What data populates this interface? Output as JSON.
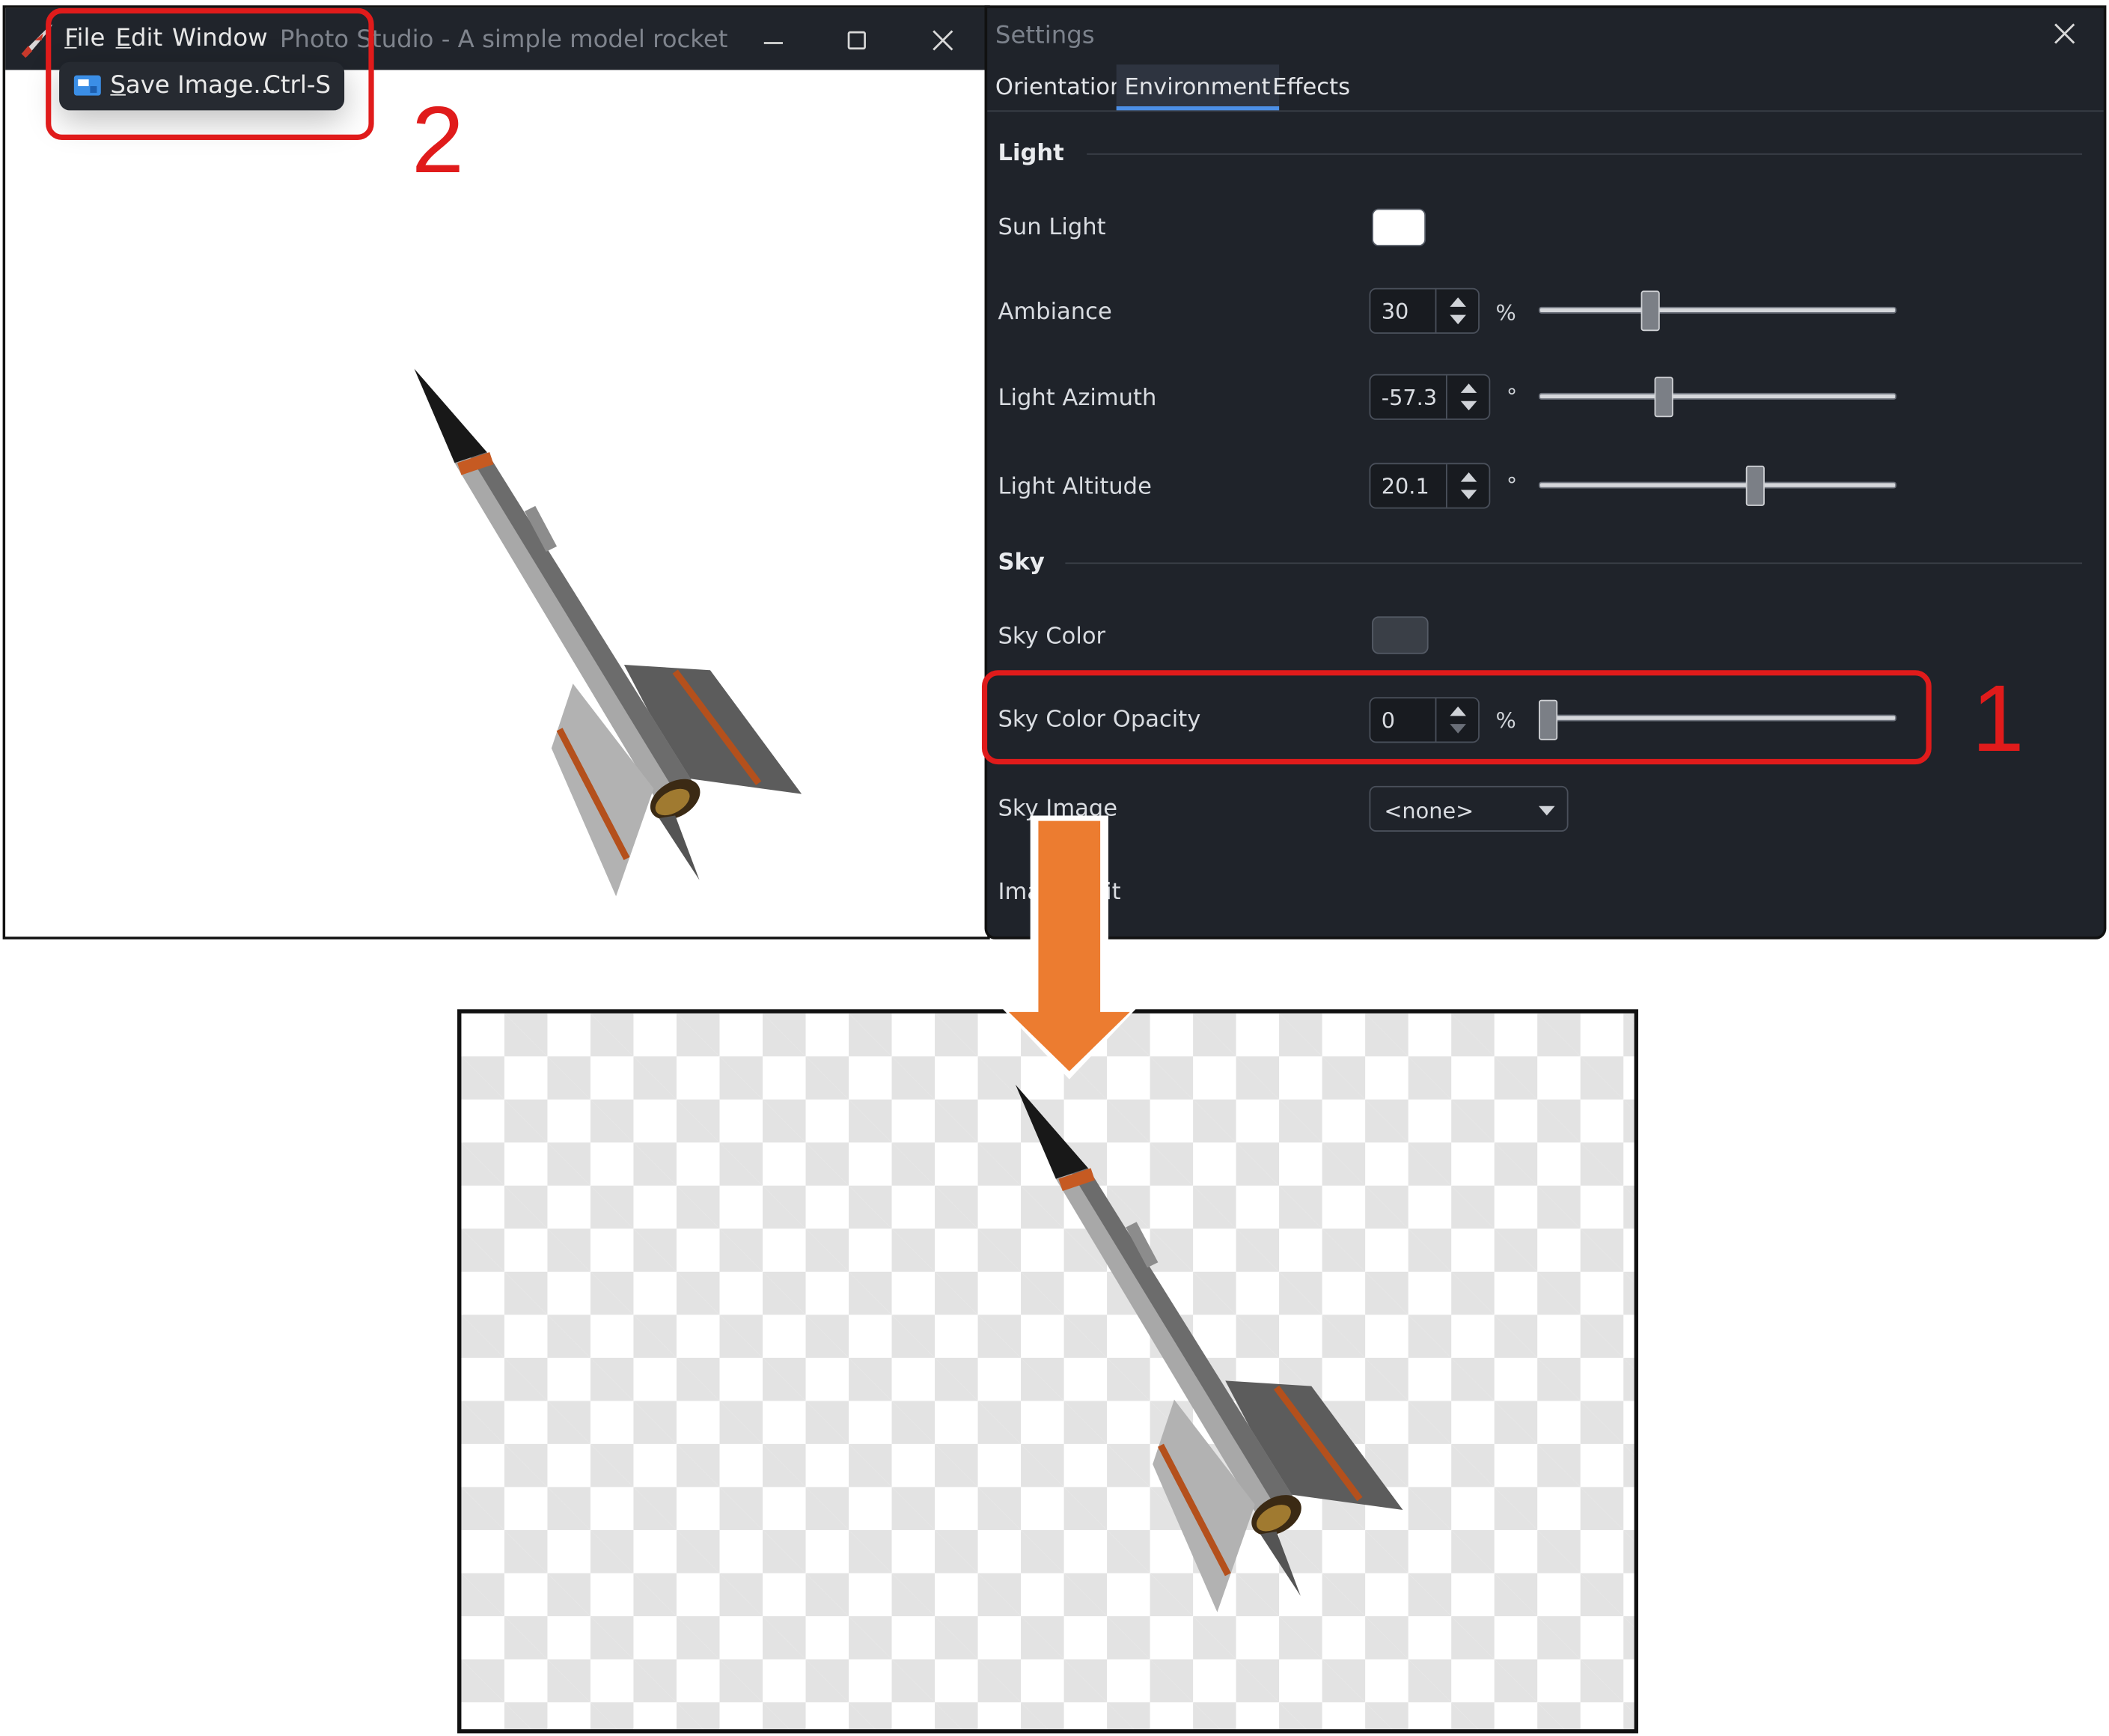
{
  "studio": {
    "menu": {
      "file": "File",
      "edit": "Edit",
      "window": "Window"
    },
    "title": "Photo Studio - A simple model rocket",
    "file_menu": {
      "save_label": "Save Image...",
      "save_shortcut": "Ctrl-S"
    }
  },
  "settings": {
    "title": "Settings",
    "tabs": [
      {
        "label": "Orientation",
        "active": false
      },
      {
        "label": "Environment",
        "active": true
      },
      {
        "label": "Effects",
        "active": false
      }
    ],
    "light": {
      "heading": "Light",
      "sun_light": {
        "label": "Sun Light",
        "color": "#ffffff"
      },
      "ambiance": {
        "label": "Ambiance",
        "value": "30",
        "unit": "%",
        "fraction": 0.3
      },
      "azimuth": {
        "label": "Light Azimuth",
        "value": "-57.3",
        "unit": "°",
        "fraction": 0.34
      },
      "altitude": {
        "label": "Light Altitude",
        "value": "20.1",
        "unit": "°",
        "fraction": 0.61
      }
    },
    "sky": {
      "heading": "Sky",
      "sky_color": {
        "label": "Sky Color",
        "color": "#3a3f47"
      },
      "sky_opacity": {
        "label": "Sky Color Opacity",
        "value": "0",
        "unit": "%",
        "fraction": 0.0
      },
      "sky_image": {
        "label": "Sky Image",
        "value": "<none>"
      },
      "image_edit": {
        "label": "Image edit"
      }
    }
  },
  "annotations": {
    "step1": "1",
    "step2": "2",
    "box_color": "#e01b1b",
    "arrow_color": "#ec7c30"
  }
}
